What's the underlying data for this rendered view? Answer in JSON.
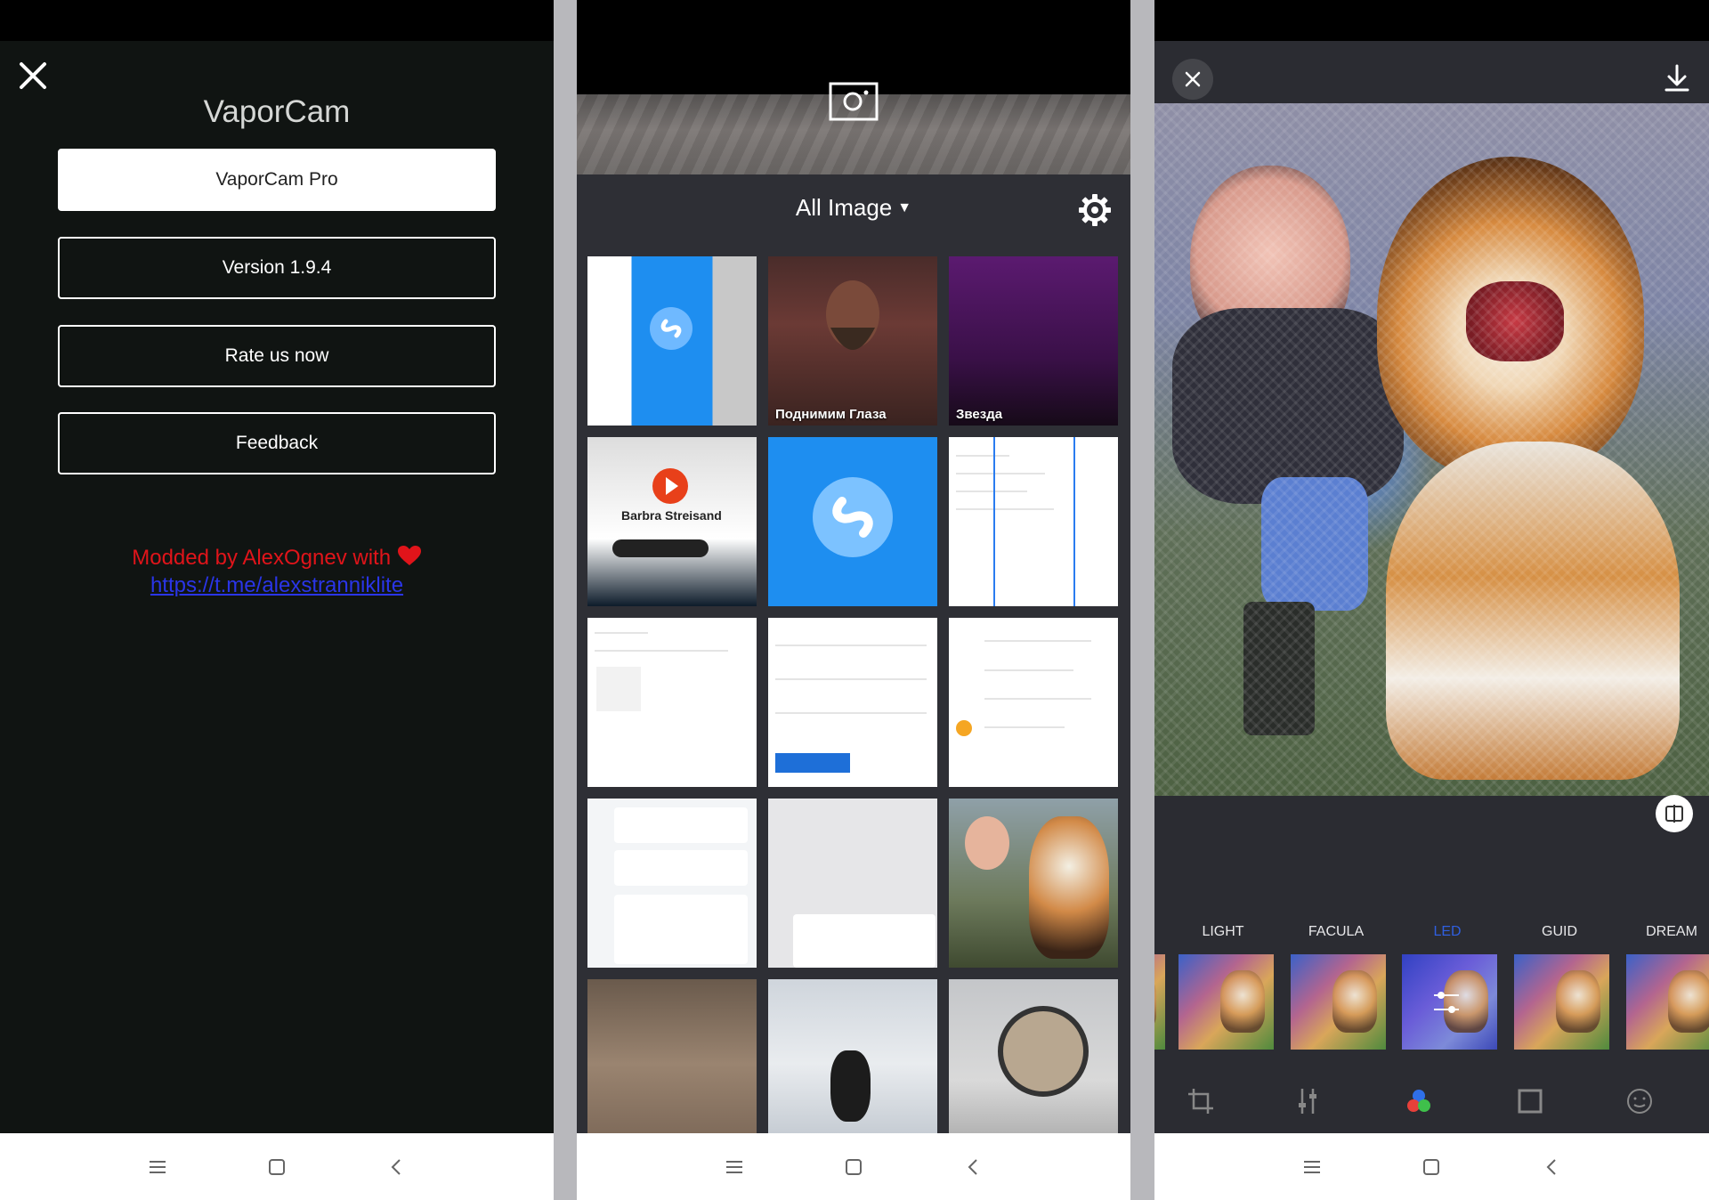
{
  "settings_screen": {
    "app_title": "VaporCam",
    "buttons": {
      "pro": "VaporCam Pro",
      "version": "Version 1.9.4",
      "rate": "Rate us now",
      "feedback": "Feedback"
    },
    "modded_text": "Modded by AlexOgnev with",
    "link": "https://t.me/alexstranniklite"
  },
  "gallery_screen": {
    "album_name": "All Image",
    "thumbnails": [
      {
        "caption": ""
      },
      {
        "caption": "Поднимим Глаза"
      },
      {
        "caption": "Звезда"
      },
      {
        "caption": "Barbra Streisand"
      },
      {
        "caption": ""
      },
      {
        "caption": ""
      },
      {
        "caption": ""
      },
      {
        "caption": ""
      },
      {
        "caption": ""
      },
      {
        "caption": ""
      },
      {
        "caption": ""
      },
      {
        "caption": ""
      },
      {
        "caption": ""
      },
      {
        "caption": ""
      },
      {
        "caption": ""
      }
    ]
  },
  "editor_screen": {
    "filters": [
      "LIGHT",
      "FACULA",
      "LED",
      "GUID",
      "DREAM"
    ],
    "active_filter": "LED"
  },
  "colors": {
    "accent_blue": "#2f5fe0",
    "modded_red": "#e0141a",
    "link_blue": "#2a35e8"
  }
}
